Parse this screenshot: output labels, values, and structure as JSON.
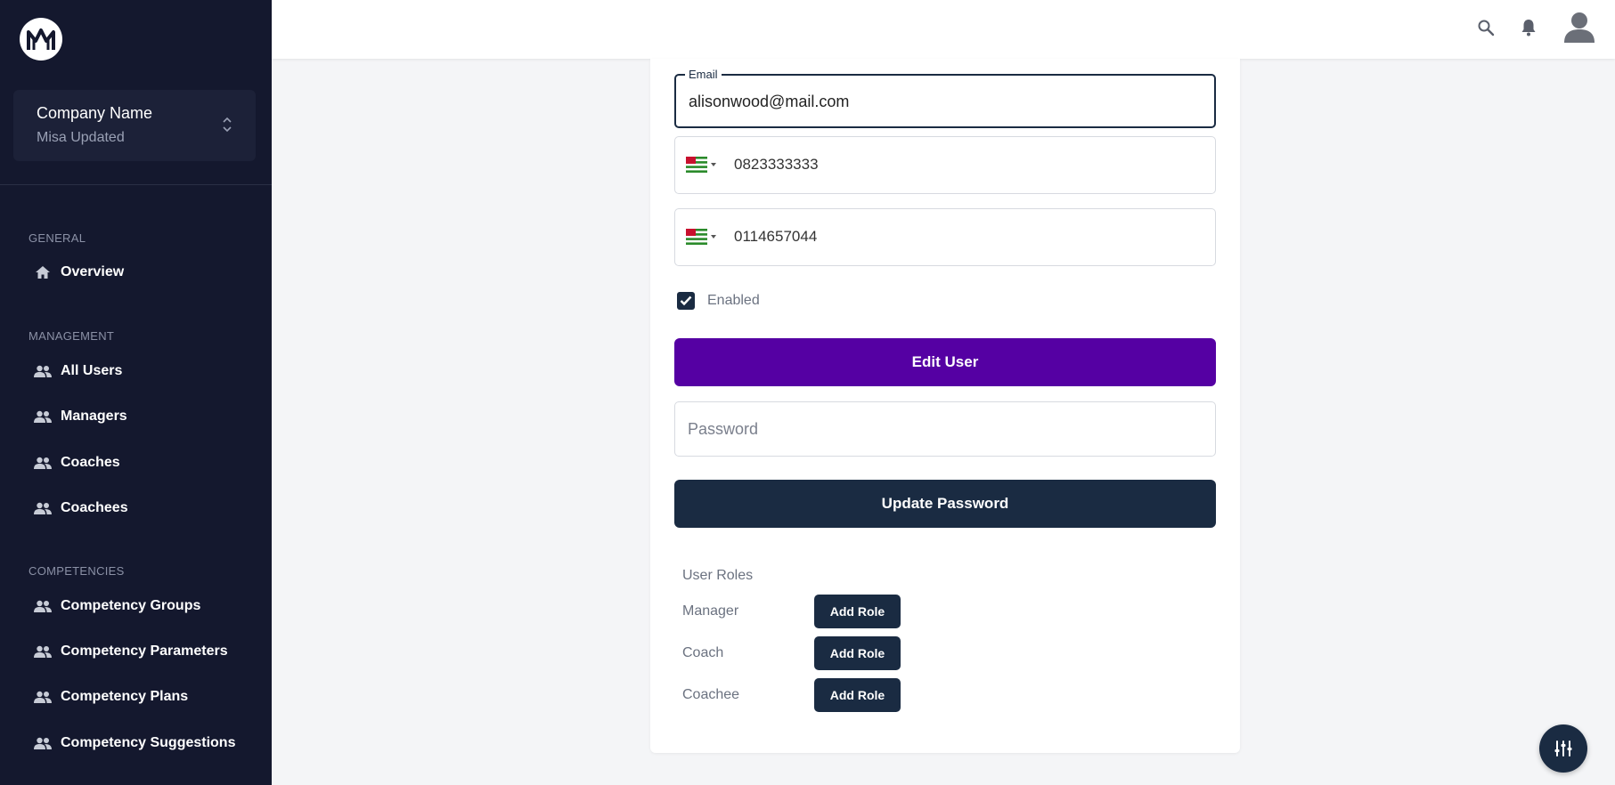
{
  "sidebar": {
    "company": {
      "title": "Company Name",
      "subtitle": "Misa Updated"
    },
    "sections": {
      "general": "GENERAL",
      "management": "MANAGEMENT",
      "competencies": "COMPETENCIES"
    },
    "items": {
      "overview": "Overview",
      "all_users": "All Users",
      "managers": "Managers",
      "coaches": "Coaches",
      "coachees": "Coachees",
      "competency_groups": "Competency Groups",
      "competency_parameters": "Competency Parameters",
      "competency_plans": "Competency Plans",
      "competency_suggestions": "Competency Suggestions"
    }
  },
  "form": {
    "email_label": "Email",
    "email_value": "alisonwood@mail.com",
    "phone1": "0823333333",
    "phone2": "0114657044",
    "enabled_label": "Enabled",
    "enabled": true,
    "edit_button": "Edit User",
    "password_placeholder": "Password",
    "update_password_button": "Update Password"
  },
  "roles": {
    "title": "User Roles",
    "items": [
      {
        "name": "Manager",
        "button": "Add Role"
      },
      {
        "name": "Coach",
        "button": "Add Role"
      },
      {
        "name": "Coachee",
        "button": "Add Role"
      }
    ]
  },
  "colors": {
    "sidebar_bg": "#14182e",
    "primary": "#5500a3",
    "dark_button": "#1a2b42"
  },
  "icons": [
    "search-icon",
    "bell-icon",
    "avatar-icon",
    "home-icon",
    "users-icon",
    "settings-sliders-icon"
  ]
}
